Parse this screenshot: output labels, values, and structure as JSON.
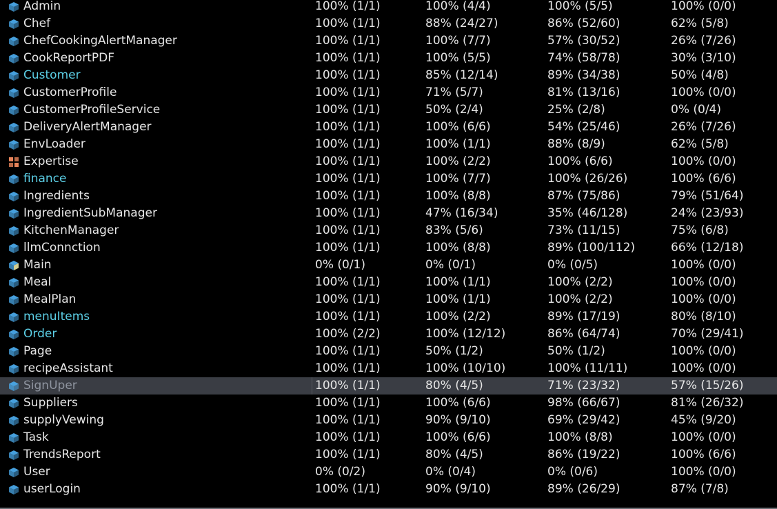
{
  "rows": [
    {
      "name": "Admin",
      "icon": "class-icon",
      "highlight": false,
      "c1": "100% (1/1)",
      "c2": "100% (4/4)",
      "c3": "100% (5/5)",
      "c4": "100% (0/0)"
    },
    {
      "name": "Chef",
      "icon": "class-icon",
      "highlight": false,
      "c1": "100% (1/1)",
      "c2": "88% (24/27)",
      "c3": "86% (52/60)",
      "c4": "62% (5/8)"
    },
    {
      "name": "ChefCookingAlertManager",
      "icon": "class-icon",
      "highlight": false,
      "c1": "100% (1/1)",
      "c2": "100% (7/7)",
      "c3": "57% (30/52)",
      "c4": "26% (7/26)"
    },
    {
      "name": "CookReportPDF",
      "icon": "class-icon",
      "highlight": false,
      "c1": "100% (1/1)",
      "c2": "100% (5/5)",
      "c3": "74% (58/78)",
      "c4": "30% (3/10)"
    },
    {
      "name": "Customer",
      "icon": "class-icon",
      "highlight": true,
      "c1": "100% (1/1)",
      "c2": "85% (12/14)",
      "c3": "89% (34/38)",
      "c4": "50% (4/8)"
    },
    {
      "name": "CustomerProfile",
      "icon": "class-icon",
      "highlight": false,
      "c1": "100% (1/1)",
      "c2": "71% (5/7)",
      "c3": "81% (13/16)",
      "c4": "100% (0/0)"
    },
    {
      "name": "CustomerProfileService",
      "icon": "class-icon",
      "highlight": false,
      "c1": "100% (1/1)",
      "c2": "50% (2/4)",
      "c3": "25% (2/8)",
      "c4": "0% (0/4)"
    },
    {
      "name": "DeliveryAlertManager",
      "icon": "class-icon",
      "highlight": false,
      "c1": "100% (1/1)",
      "c2": "100% (6/6)",
      "c3": "54% (25/46)",
      "c4": "26% (7/26)"
    },
    {
      "name": "EnvLoader",
      "icon": "class-icon",
      "highlight": false,
      "c1": "100% (1/1)",
      "c2": "100% (1/1)",
      "c3": "88% (8/9)",
      "c4": "62% (5/8)"
    },
    {
      "name": "Expertise",
      "icon": "enum-icon",
      "highlight": false,
      "c1": "100% (1/1)",
      "c2": "100% (2/2)",
      "c3": "100% (6/6)",
      "c4": "100% (0/0)"
    },
    {
      "name": "finance",
      "icon": "class-icon",
      "highlight": true,
      "c1": "100% (1/1)",
      "c2": "100% (7/7)",
      "c3": "100% (26/26)",
      "c4": "100% (6/6)"
    },
    {
      "name": "Ingredients",
      "icon": "class-icon",
      "highlight": false,
      "c1": "100% (1/1)",
      "c2": "100% (8/8)",
      "c3": "87% (75/86)",
      "c4": "79% (51/64)"
    },
    {
      "name": "IngredientSubManager",
      "icon": "class-icon",
      "highlight": false,
      "c1": "100% (1/1)",
      "c2": "47% (16/34)",
      "c3": "35% (46/128)",
      "c4": "24% (23/93)"
    },
    {
      "name": "KitchenManager",
      "icon": "class-icon",
      "highlight": false,
      "c1": "100% (1/1)",
      "c2": "83% (5/6)",
      "c3": "73% (11/15)",
      "c4": "75% (6/8)"
    },
    {
      "name": "llmConnction",
      "icon": "class-icon",
      "highlight": false,
      "c1": "100% (1/1)",
      "c2": "100% (8/8)",
      "c3": "89% (100/112)",
      "c4": "66% (12/18)"
    },
    {
      "name": "Main",
      "icon": "main-class-icon",
      "highlight": false,
      "c1": "0% (0/1)",
      "c2": "0% (0/1)",
      "c3": "0% (0/5)",
      "c4": "100% (0/0)"
    },
    {
      "name": "Meal",
      "icon": "class-icon",
      "highlight": false,
      "c1": "100% (1/1)",
      "c2": "100% (1/1)",
      "c3": "100% (2/2)",
      "c4": "100% (0/0)"
    },
    {
      "name": "MealPlan",
      "icon": "class-icon",
      "highlight": false,
      "c1": "100% (1/1)",
      "c2": "100% (1/1)",
      "c3": "100% (2/2)",
      "c4": "100% (0/0)"
    },
    {
      "name": "menuItems",
      "icon": "class-icon",
      "highlight": true,
      "c1": "100% (1/1)",
      "c2": "100% (2/2)",
      "c3": "89% (17/19)",
      "c4": "80% (8/10)"
    },
    {
      "name": "Order",
      "icon": "class-icon",
      "highlight": true,
      "c1": "100% (2/2)",
      "c2": "100% (12/12)",
      "c3": "86% (64/74)",
      "c4": "70% (29/41)"
    },
    {
      "name": "Page",
      "icon": "class-icon",
      "highlight": false,
      "c1": "100% (1/1)",
      "c2": "50% (1/2)",
      "c3": "50% (1/2)",
      "c4": "100% (0/0)"
    },
    {
      "name": "recipeAssistant",
      "icon": "class-icon",
      "highlight": false,
      "c1": "100% (1/1)",
      "c2": "100% (10/10)",
      "c3": "100% (11/11)",
      "c4": "100% (0/0)"
    },
    {
      "name": "SignUper",
      "icon": "class-icon",
      "highlight": false,
      "selected": true,
      "c1": "100% (1/1)",
      "c2": "80% (4/5)",
      "c3": "71% (23/32)",
      "c4": "57% (15/26)"
    },
    {
      "name": "Suppliers",
      "icon": "class-icon",
      "highlight": false,
      "c1": "100% (1/1)",
      "c2": "100% (6/6)",
      "c3": "98% (66/67)",
      "c4": "81% (26/32)"
    },
    {
      "name": "supplyVewing",
      "icon": "class-icon",
      "highlight": false,
      "c1": "100% (1/1)",
      "c2": "90% (9/10)",
      "c3": "69% (29/42)",
      "c4": "45% (9/20)"
    },
    {
      "name": "Task",
      "icon": "class-icon",
      "highlight": false,
      "c1": "100% (1/1)",
      "c2": "100% (6/6)",
      "c3": "100% (8/8)",
      "c4": "100% (0/0)"
    },
    {
      "name": "TrendsReport",
      "icon": "class-icon",
      "highlight": false,
      "c1": "100% (1/1)",
      "c2": "80% (4/5)",
      "c3": "86% (19/22)",
      "c4": "100% (6/6)"
    },
    {
      "name": "User",
      "icon": "class-icon",
      "highlight": false,
      "c1": "0% (0/2)",
      "c2": "0% (0/4)",
      "c3": "0% (0/6)",
      "c4": "100% (0/0)"
    },
    {
      "name": "userLogin",
      "icon": "class-icon",
      "highlight": false,
      "c1": "100% (1/1)",
      "c2": "90% (9/10)",
      "c3": "89% (26/29)",
      "c4": "87% (7/8)"
    }
  ],
  "colors": {
    "class_icon": "#4aa8e8",
    "enum_icon": "#e8845a",
    "highlight_text": "#5ccfe6",
    "selected_row": "#3a3d44"
  }
}
